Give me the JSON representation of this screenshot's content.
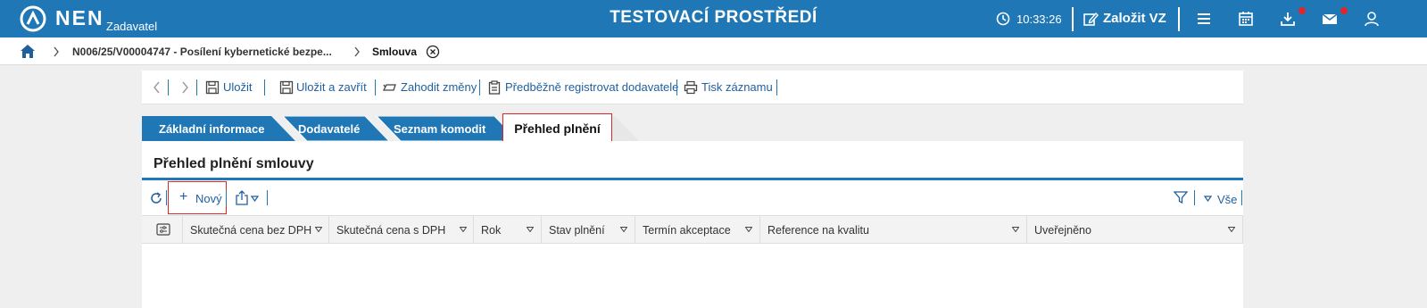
{
  "header": {
    "logo_text": "NEN",
    "logo_sub": "Zadavatel",
    "env_title": "TESTOVACÍ PROSTŘEDÍ",
    "time": "10:33:26",
    "create_label": "Založit VZ",
    "icons": [
      "clock-icon",
      "edit-icon",
      "menu-icon",
      "calendar-icon",
      "download-icon",
      "mail-icon",
      "user-icon"
    ],
    "notification_color": "#e0262b"
  },
  "breadcrumb": {
    "items": [
      "N006/25/V00004747 - Posílení kybernetické bezpe...",
      "Smlouva"
    ]
  },
  "toolbar": {
    "save": "Uložit",
    "save_close": "Uložit a zavřít",
    "discard": "Zahodit změny",
    "prereg": "Předběžně registrovat dodavatele",
    "print": "Tisk záznamu"
  },
  "tabs": [
    {
      "label": "Základní informace"
    },
    {
      "label": "Dodavatelé"
    },
    {
      "label": "Seznam komodit"
    },
    {
      "label": "Přehled plnění",
      "active": true
    }
  ],
  "section": {
    "title": "Přehled plnění smlouvy",
    "new_label": "Nový",
    "filter_all": "Vše"
  },
  "table": {
    "columns": [
      "Skutečná cena bez DPH",
      "Skutečná cena s DPH",
      "Rok",
      "Stav plnění",
      "Termín akceptace",
      "Reference na kvalitu",
      "Uveřejněno"
    ],
    "rows": []
  },
  "colors": {
    "primary": "#1f77b6",
    "link": "#1f5f9e",
    "highlight": "#d9262b"
  }
}
